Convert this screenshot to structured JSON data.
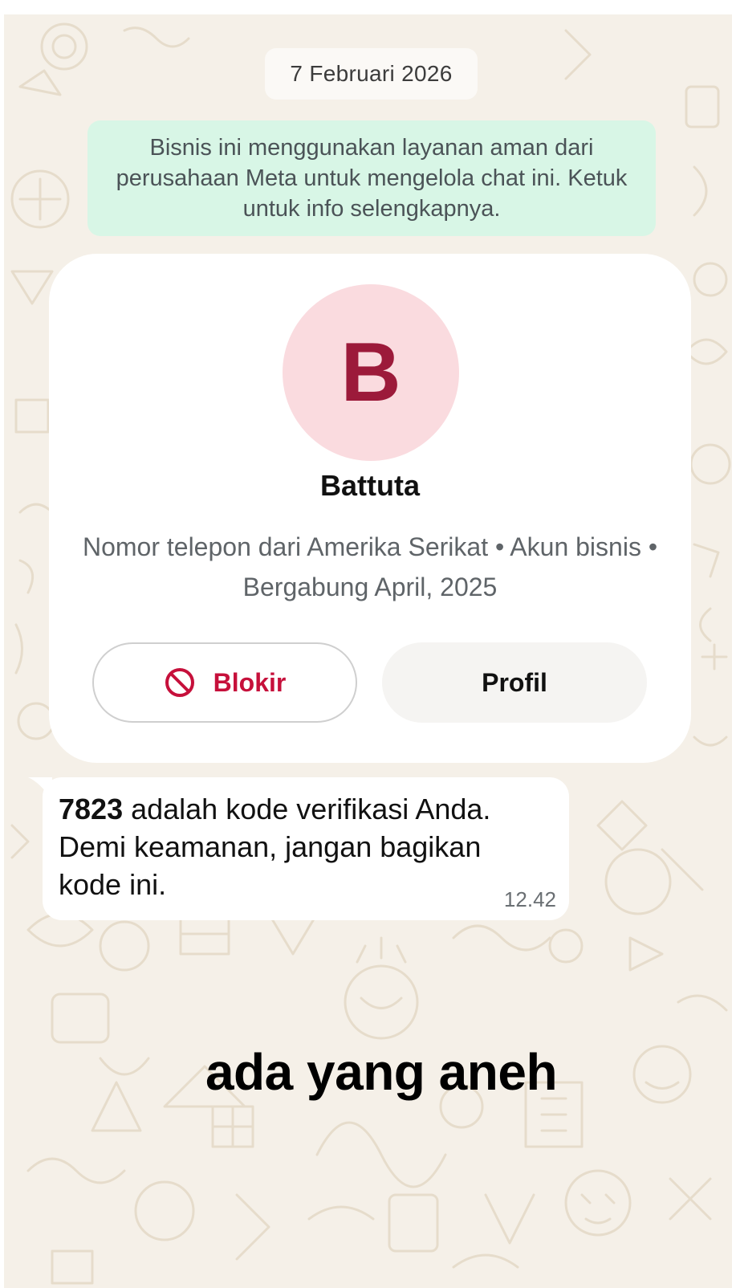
{
  "date_chip": "7 Februari 2026",
  "meta_notice": "Bisnis ini menggunakan layanan aman dari perusahaan Meta untuk mengelola chat ini. Ketuk untuk info selengkapnya.",
  "profile_card": {
    "avatar_initial": "B",
    "name": "Battuta",
    "info": "Nomor telepon dari Amerika Serikat • Akun bisnis • Bergabung April, 2025",
    "block_button": "Blokir",
    "profile_button": "Profil"
  },
  "message": {
    "code": "7823",
    "text": " adalah kode verifikasi Anda. Demi keamanan, jangan bagikan kode ini.",
    "time": "12.42"
  },
  "caption": "ada yang aneh",
  "colors": {
    "chat_background": "#f5f0e8",
    "notice_background": "#d8f6e6",
    "avatar_background": "#fadbdf",
    "avatar_letter": "#9c1a3a",
    "block_red": "#c6103b"
  },
  "icons": {
    "block": "block-icon"
  }
}
